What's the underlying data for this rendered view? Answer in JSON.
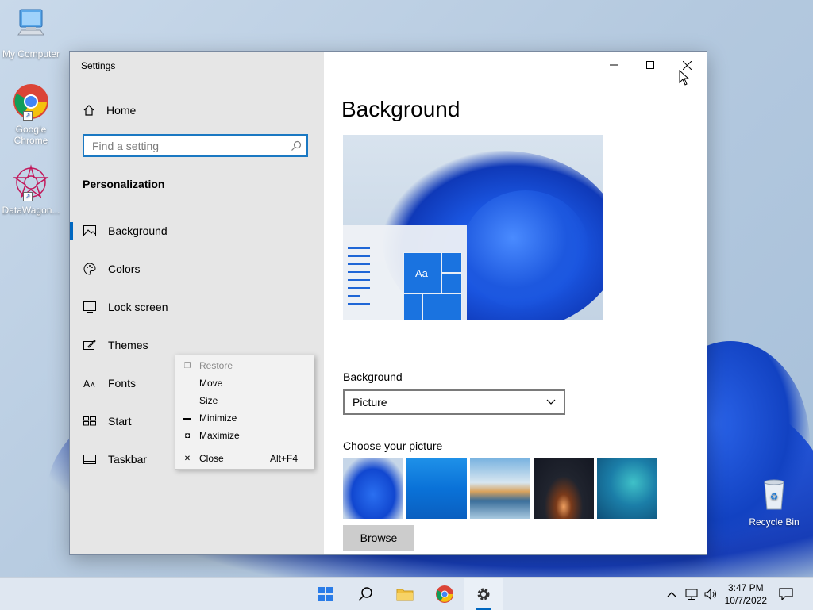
{
  "desktop": {
    "icons": [
      {
        "label": "My Computer"
      },
      {
        "label": "Google Chrome"
      },
      {
        "label": "DataWagon..."
      },
      {
        "label": "Recycle Bin"
      }
    ]
  },
  "window": {
    "title": "Settings",
    "caption": {
      "minimize": "minimize-icon",
      "maximize": "maximize-icon",
      "close": "close-icon"
    }
  },
  "sidebar": {
    "home_label": "Home",
    "search_placeholder": "Find a setting",
    "section_title": "Personalization",
    "items": [
      {
        "label": "Background",
        "icon": "picture-icon",
        "active": true
      },
      {
        "label": "Colors",
        "icon": "palette-icon"
      },
      {
        "label": "Lock screen",
        "icon": "lock-screen-icon"
      },
      {
        "label": "Themes",
        "icon": "themes-icon"
      },
      {
        "label": "Fonts",
        "icon": "fonts-icon"
      },
      {
        "label": "Start",
        "icon": "start-icon"
      },
      {
        "label": "Taskbar",
        "icon": "taskbar-icon"
      }
    ]
  },
  "content": {
    "page_title": "Background",
    "preview": {
      "tile_text": "Aa"
    },
    "background_label": "Background",
    "background_value": "Picture",
    "choose_label": "Choose your picture",
    "browse_label": "Browse"
  },
  "context_menu": {
    "items": [
      {
        "label": "Restore",
        "disabled": true
      },
      {
        "label": "Move"
      },
      {
        "label": "Size"
      },
      {
        "label": "Minimize"
      },
      {
        "label": "Maximize"
      },
      {
        "label": "Close",
        "accelerator": "Alt+F4"
      }
    ]
  },
  "taskbar": {
    "time": "3:47 PM",
    "date": "10/7/2022"
  },
  "colors": {
    "accent": "#0067c0",
    "sidebar": "#e6e6e6"
  }
}
